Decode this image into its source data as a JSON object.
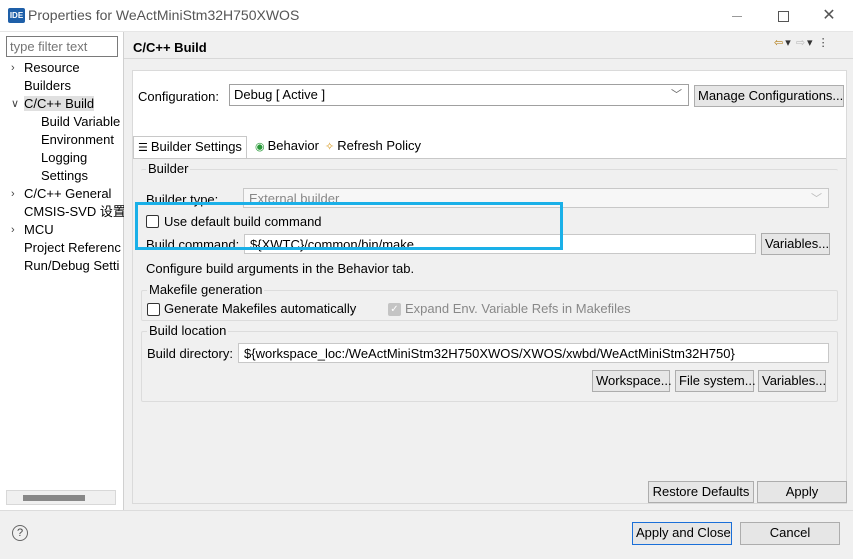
{
  "window": {
    "app_icon": "IDE",
    "title": "Properties for WeActMiniStm32H750XWOS",
    "minimize_icon": "minimize-icon",
    "maximize_icon": "maximize-icon",
    "close_label": "✕"
  },
  "sidebar": {
    "filter_placeholder": "type filter text",
    "items": [
      {
        "label": "Resource",
        "expandable": true,
        "expanded": false,
        "indent": 0
      },
      {
        "label": "Builders",
        "expandable": false,
        "indent": 0
      },
      {
        "label": "C/C++ Build",
        "expandable": true,
        "expanded": true,
        "indent": 0,
        "selected": true
      },
      {
        "label": "Build Variable",
        "expandable": false,
        "indent": 1
      },
      {
        "label": "Environment",
        "expandable": false,
        "indent": 1
      },
      {
        "label": "Logging",
        "expandable": false,
        "indent": 1
      },
      {
        "label": "Settings",
        "expandable": false,
        "indent": 1
      },
      {
        "label": "C/C++ General",
        "expandable": true,
        "expanded": false,
        "indent": 0
      },
      {
        "label": "CMSIS-SVD 设置",
        "expandable": false,
        "indent": 0
      },
      {
        "label": "MCU",
        "expandable": true,
        "expanded": false,
        "indent": 0
      },
      {
        "label": "Project Referenc",
        "expandable": false,
        "indent": 0
      },
      {
        "label": "Run/Debug Setti",
        "expandable": false,
        "indent": 0
      }
    ]
  },
  "main": {
    "page_title": "C/C++ Build",
    "nav": {
      "back": "⇦",
      "back_menu": "▾",
      "forward": "⇨",
      "forward_menu": "▾",
      "more": "⋮"
    },
    "configuration": {
      "label": "Configuration:",
      "value": "Debug  [ Active ]",
      "manage_button": "Manage Configurations..."
    },
    "tabs": [
      {
        "label": "Builder Settings",
        "icon": "☰",
        "active": true
      },
      {
        "label": "Behavior",
        "icon": "◉",
        "active": false
      },
      {
        "label": "Refresh Policy",
        "icon": "✧",
        "active": false
      }
    ],
    "builder": {
      "group_title": "Builder",
      "type_label": "Builder type:",
      "type_value": "External builder",
      "use_default_label": "Use default build command",
      "use_default_checked": false,
      "command_label": "Build command:",
      "command_value": "${XWTC}/common/bin/make",
      "variables_button": "Variables...",
      "hint": "Configure build arguments in the Behavior tab."
    },
    "makefile": {
      "group_title": "Makefile generation",
      "generate_label": "Generate Makefiles automatically",
      "generate_checked": false,
      "expand_label": "Expand Env. Variable Refs in Makefiles",
      "expand_checked": true
    },
    "location": {
      "group_title": "Build location",
      "dir_label": "Build directory:",
      "dir_value": "${workspace_loc:/WeActMiniStm32H750XWOS/XWOS/xwbd/WeActMiniStm32H750}",
      "workspace_button": "Workspace...",
      "filesystem_button": "File system...",
      "variables_button": "Variables..."
    },
    "restore_defaults_button": "Restore Defaults",
    "apply_button": "Apply"
  },
  "footer": {
    "help_icon": "?",
    "apply_close_button": "Apply and Close",
    "cancel_button": "Cancel"
  },
  "colors": {
    "highlight_box": "#1ab0e8",
    "default_button_border": "#1a6fd8"
  }
}
